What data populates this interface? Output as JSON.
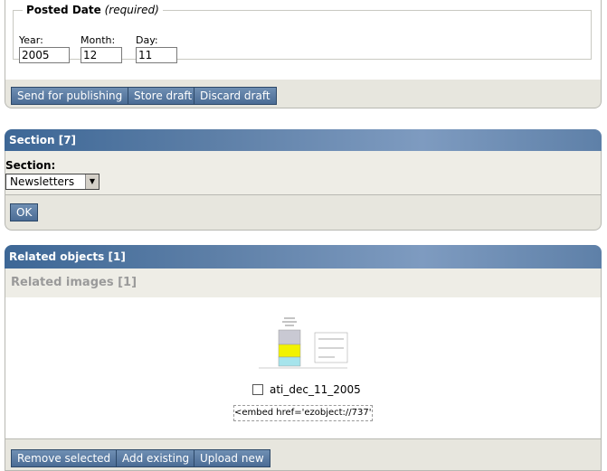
{
  "posted_date": {
    "legend_title": "Posted Date",
    "legend_note": "(required)",
    "year_label": "Year:",
    "year_value": "2005",
    "month_label": "Month:",
    "month_value": "12",
    "day_label": "Day:",
    "day_value": "11"
  },
  "publish_bar": {
    "send_label": "Send for publishing",
    "store_label": "Store draft",
    "discard_label": "Discard draft"
  },
  "section": {
    "header": "Section [7]",
    "field_label": "Section:",
    "selected": "Newsletters",
    "ok_label": "OK"
  },
  "related": {
    "header": "Related objects [1]",
    "images_header": "Related images [1]",
    "item_name": "ati_dec_11_2005",
    "embed_code": "<embed href='ezobject://737' />",
    "remove_label": "Remove selected",
    "add_label": "Add existing",
    "upload_label": "Upload new"
  },
  "colors": {
    "header_blue": "#4f739e",
    "button_blue": "#5a7ba3",
    "panel_grey": "#eeede6"
  }
}
